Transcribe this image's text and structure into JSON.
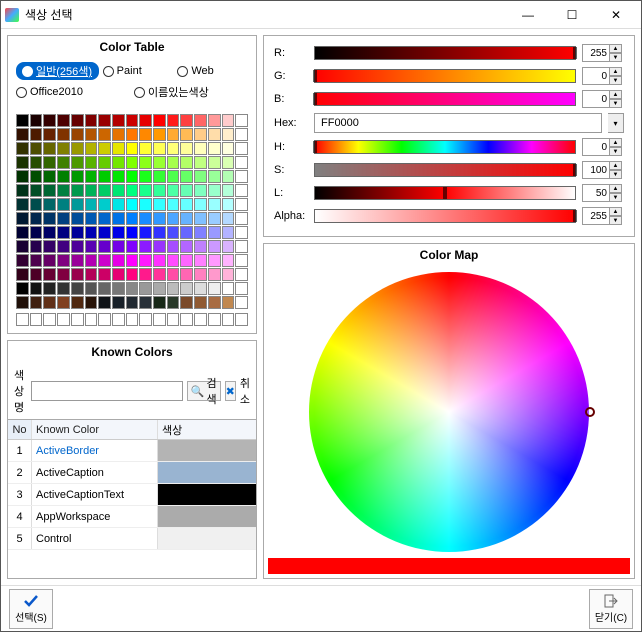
{
  "window_title": "색상 선택",
  "colortable_title": "Color Table",
  "radios": {
    "selected": "일반(256색)",
    "r1": [
      "일반(256색)",
      "Paint",
      "Web"
    ],
    "r2": [
      "Office2010",
      "이름있는색상"
    ]
  },
  "known_title": "Known Colors",
  "search_label": "색상명",
  "search_btn": "검색",
  "cancel_btn": "취소",
  "table_headers": {
    "no": "No",
    "name": "Known Color",
    "color": "색상"
  },
  "known_rows": [
    {
      "no": "1",
      "name": "ActiveBorder",
      "hex": "#B4B4B4"
    },
    {
      "no": "2",
      "name": "ActiveCaption",
      "hex": "#99B4D1"
    },
    {
      "no": "3",
      "name": "ActiveCaptionText",
      "hex": "#000000"
    },
    {
      "no": "4",
      "name": "AppWorkspace",
      "hex": "#ABABAB"
    },
    {
      "no": "5",
      "name": "Control",
      "hex": "#F0F0F0"
    }
  ],
  "sliders": {
    "R": {
      "label": "R:",
      "value": "255",
      "gradient": "linear-gradient(90deg,#000,#f00)",
      "marker": "100%"
    },
    "G": {
      "label": "G:",
      "value": "0",
      "gradient": "linear-gradient(90deg,#f00,#ff0)",
      "marker": "0%"
    },
    "B": {
      "label": "B:",
      "value": "0",
      "gradient": "linear-gradient(90deg,#f00,#f0f)",
      "marker": "0%"
    },
    "Hex": {
      "label": "Hex:",
      "value": "FF0000"
    },
    "H": {
      "label": "H:",
      "value": "0",
      "gradient": "linear-gradient(90deg,red,yellow,lime,cyan,blue,magenta,red)",
      "marker": "0%"
    },
    "S": {
      "label": "S:",
      "value": "100",
      "gradient": "linear-gradient(90deg,#808080,#f00)",
      "marker": "100%"
    },
    "L": {
      "label": "L:",
      "value": "50",
      "gradient": "linear-gradient(90deg,#000,#f00,#fff)",
      "marker": "50%"
    },
    "Alpha": {
      "label": "Alpha:",
      "value": "255",
      "gradient": "linear-gradient(90deg,#fff,#f00)",
      "marker": "100%"
    }
  },
  "colormap_title": "Color Map",
  "preview_color": "#ff0000",
  "footer": {
    "select": "선택(S)",
    "close": "닫기(C)"
  },
  "palette_colors": [
    [
      "#000000",
      "#1a0000",
      "#330000",
      "#4d0000",
      "#660000",
      "#800000",
      "#990000",
      "#b30000",
      "#cc0000",
      "#e60000",
      "#ff0000",
      "#ff1a1a",
      "#ff4040",
      "#ff6666",
      "#ff9999",
      "#ffcccc"
    ],
    [
      "#331100",
      "#4d1a00",
      "#662200",
      "#803300",
      "#994400",
      "#b35500",
      "#cc6600",
      "#e67300",
      "#ff7700",
      "#ff8800",
      "#ff9900",
      "#ffaa33",
      "#ffbb55",
      "#ffcc88",
      "#ffddaa",
      "#ffeecc"
    ],
    [
      "#333300",
      "#4d4d00",
      "#666600",
      "#808000",
      "#999900",
      "#b3b300",
      "#cccc00",
      "#e6e600",
      "#ffff00",
      "#ffff33",
      "#ffff55",
      "#ffff77",
      "#ffff99",
      "#ffffbb",
      "#ffffcc",
      "#ffffe0"
    ],
    [
      "#1a3300",
      "#264d00",
      "#336600",
      "#408000",
      "#4d9900",
      "#59b300",
      "#66cc00",
      "#73e600",
      "#80ff00",
      "#8cff1a",
      "#99ff33",
      "#a6ff4d",
      "#b3ff66",
      "#c0ff80",
      "#ccff99",
      "#d9ffb3"
    ],
    [
      "#003300",
      "#004d00",
      "#006600",
      "#008000",
      "#009900",
      "#00b300",
      "#00cc00",
      "#00e600",
      "#00ff00",
      "#1aff1a",
      "#33ff33",
      "#4dff4d",
      "#66ff66",
      "#80ff80",
      "#99ff99",
      "#b3ffb3"
    ],
    [
      "#003319",
      "#004d26",
      "#006633",
      "#008040",
      "#00994d",
      "#00b359",
      "#00cc66",
      "#00e673",
      "#00ff80",
      "#1aff8c",
      "#33ff99",
      "#4dffa6",
      "#66ffb3",
      "#80ffc0",
      "#99ffcc",
      "#b3ffd9"
    ],
    [
      "#003333",
      "#004d4d",
      "#006666",
      "#008080",
      "#009999",
      "#00b3b3",
      "#00cccc",
      "#00e6e6",
      "#00ffff",
      "#1affff",
      "#33ffff",
      "#4dffff",
      "#66ffff",
      "#80ffff",
      "#99ffff",
      "#b3ffff"
    ],
    [
      "#001933",
      "#00264d",
      "#003366",
      "#004080",
      "#004d99",
      "#0059b3",
      "#0066cc",
      "#0073e6",
      "#0080ff",
      "#1a8cff",
      "#3399ff",
      "#4da6ff",
      "#66b3ff",
      "#80c0ff",
      "#99ccff",
      "#b3d9ff"
    ],
    [
      "#000033",
      "#00004d",
      "#000066",
      "#000080",
      "#000099",
      "#0000b3",
      "#0000cc",
      "#0000e6",
      "#0000ff",
      "#1a1aff",
      "#3333ff",
      "#4d4dff",
      "#6666ff",
      "#8080ff",
      "#9999ff",
      "#b3b3ff"
    ],
    [
      "#190033",
      "#26004d",
      "#330066",
      "#400080",
      "#4d0099",
      "#5900b3",
      "#6600cc",
      "#7300e6",
      "#8000ff",
      "#8c1aff",
      "#9933ff",
      "#a64dff",
      "#b366ff",
      "#c080ff",
      "#cc99ff",
      "#d9b3ff"
    ],
    [
      "#330033",
      "#4d004d",
      "#660066",
      "#800080",
      "#990099",
      "#b300b3",
      "#cc00cc",
      "#e600e6",
      "#ff00ff",
      "#ff1aff",
      "#ff33ff",
      "#ff4dff",
      "#ff66ff",
      "#ff80ff",
      "#ff99ff",
      "#ffb3ff"
    ],
    [
      "#330019",
      "#4d0026",
      "#660033",
      "#800040",
      "#99004d",
      "#b30059",
      "#cc0066",
      "#e60073",
      "#ff0080",
      "#ff1a8c",
      "#ff3399",
      "#ff4da6",
      "#ff66b3",
      "#ff80c0",
      "#ff99cc",
      "#ffb3d9"
    ],
    [
      "#000000",
      "#111111",
      "#222222",
      "#333333",
      "#444444",
      "#555555",
      "#666666",
      "#777777",
      "#888888",
      "#999999",
      "#aaaaaa",
      "#bbbbbb",
      "#cccccc",
      "#dddddd",
      "#eeeeee",
      "#ffffff"
    ],
    [
      "#201008",
      "#402010",
      "#603018",
      "#804020",
      "#502810",
      "#281408",
      "#101418",
      "#182028",
      "#202830",
      "#283038",
      "#182818",
      "#283828",
      "#7a4a2a",
      "#905a32",
      "#a86c42",
      "#c08850"
    ]
  ]
}
